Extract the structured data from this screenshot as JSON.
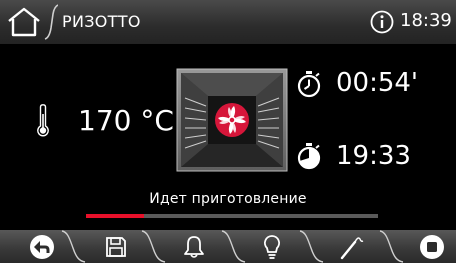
{
  "header": {
    "title": "РИЗОТТО",
    "time": "18:39",
    "home_icon": "home-icon",
    "info_icon": "info-icon"
  },
  "cooking": {
    "temperature": "170 °C",
    "timer_remaining": "00:54'",
    "end_time": "19:33",
    "status": "Идет приготовление",
    "progress": 0.2
  },
  "toolbar": {
    "icons": [
      "back-icon",
      "save-icon",
      "bell-icon",
      "light-icon",
      "probe-icon",
      "stop-icon"
    ]
  },
  "colors": {
    "accent": "#e8102a",
    "fan": "#d6163a",
    "text": "#ffffff",
    "background": "#000000"
  }
}
